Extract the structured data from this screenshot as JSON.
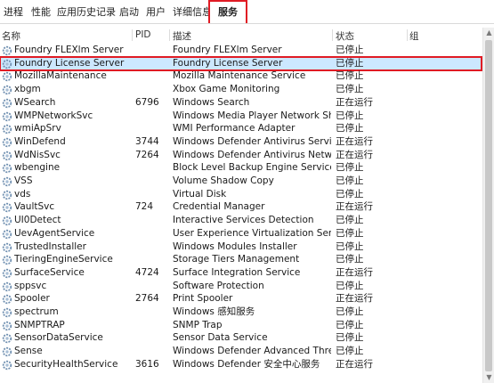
{
  "tabs": [
    "进程",
    "性能",
    "应用历史记录",
    "启动",
    "用户",
    "详细信息",
    "服务"
  ],
  "columns": {
    "name": "名称",
    "pid": "PID",
    "desc": "描述",
    "status": "状态",
    "group": "组"
  },
  "colors": {
    "highlight": "#e01b24",
    "selected": "#cce8ff"
  },
  "rows": [
    {
      "name": "Foundry FLEXlm Server",
      "pid": "",
      "desc": "Foundry FLEXlm Server",
      "status": "已停止"
    },
    {
      "name": "Foundry License Server",
      "pid": "",
      "desc": "Foundry License Server",
      "status": "已停止"
    },
    {
      "name": "MozillaMaintenance",
      "pid": "",
      "desc": "Mozilla Maintenance Service",
      "status": "已停止"
    },
    {
      "name": "xbgm",
      "pid": "",
      "desc": "Xbox Game Monitoring",
      "status": "已停止"
    },
    {
      "name": "WSearch",
      "pid": "6796",
      "desc": "Windows Search",
      "status": "正在运行"
    },
    {
      "name": "WMPNetworkSvc",
      "pid": "",
      "desc": "Windows Media Player Network Sh...",
      "status": "已停止"
    },
    {
      "name": "wmiApSrv",
      "pid": "",
      "desc": "WMI Performance Adapter",
      "status": "已停止"
    },
    {
      "name": "WinDefend",
      "pid": "3744",
      "desc": "Windows Defender Antivirus Service",
      "status": "正在运行"
    },
    {
      "name": "WdNisSvc",
      "pid": "7264",
      "desc": "Windows Defender Antivirus Netw...",
      "status": "正在运行"
    },
    {
      "name": "wbengine",
      "pid": "",
      "desc": "Block Level Backup Engine Service",
      "status": "已停止"
    },
    {
      "name": "VSS",
      "pid": "",
      "desc": "Volume Shadow Copy",
      "status": "已停止"
    },
    {
      "name": "vds",
      "pid": "",
      "desc": "Virtual Disk",
      "status": "已停止"
    },
    {
      "name": "VaultSvc",
      "pid": "724",
      "desc": "Credential Manager",
      "status": "正在运行"
    },
    {
      "name": "UI0Detect",
      "pid": "",
      "desc": "Interactive Services Detection",
      "status": "已停止"
    },
    {
      "name": "UevAgentService",
      "pid": "",
      "desc": "User Experience Virtualization Servi...",
      "status": "已停止"
    },
    {
      "name": "TrustedInstaller",
      "pid": "",
      "desc": "Windows Modules Installer",
      "status": "已停止"
    },
    {
      "name": "TieringEngineService",
      "pid": "",
      "desc": "Storage Tiers Management",
      "status": "已停止"
    },
    {
      "name": "SurfaceService",
      "pid": "4724",
      "desc": "Surface Integration Service",
      "status": "正在运行"
    },
    {
      "name": "sppsvc",
      "pid": "",
      "desc": "Software Protection",
      "status": "已停止"
    },
    {
      "name": "Spooler",
      "pid": "2764",
      "desc": "Print Spooler",
      "status": "正在运行"
    },
    {
      "name": "spectrum",
      "pid": "",
      "desc": "Windows 感知服务",
      "status": "已停止"
    },
    {
      "name": "SNMPTRAP",
      "pid": "",
      "desc": "SNMP Trap",
      "status": "已停止"
    },
    {
      "name": "SensorDataService",
      "pid": "",
      "desc": "Sensor Data Service",
      "status": "已停止"
    },
    {
      "name": "Sense",
      "pid": "",
      "desc": "Windows Defender Advanced Thre...",
      "status": "已停止"
    },
    {
      "name": "SecurityHealthService",
      "pid": "3616",
      "desc": "Windows Defender 安全中心服务",
      "status": "正在运行"
    }
  ]
}
